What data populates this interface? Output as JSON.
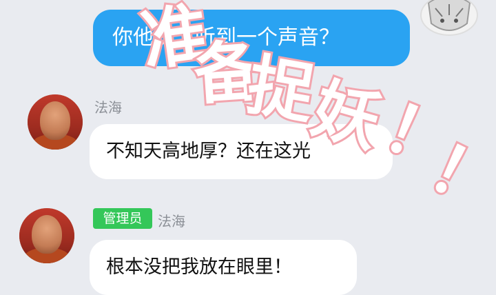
{
  "messages": {
    "outgoing": {
      "text": "你他说，听到一个声音？"
    },
    "incoming": [
      {
        "sender": "法海",
        "text": "不知天高地厚？还在这光"
      },
      {
        "badge": "管理员",
        "sender": "法海",
        "text": "根本没把我放在眼里！"
      }
    ]
  },
  "overlay": {
    "chars": [
      "准",
      "备",
      "捉",
      "妖",
      "！",
      "！"
    ],
    "stroke_color": "#f2a5ae",
    "fill_color": "#ffffff"
  },
  "colors": {
    "background": "#e9ebf0",
    "outgoing_bubble": "#2aa3f2",
    "incoming_bubble": "#ffffff",
    "badge": "#34c759"
  }
}
